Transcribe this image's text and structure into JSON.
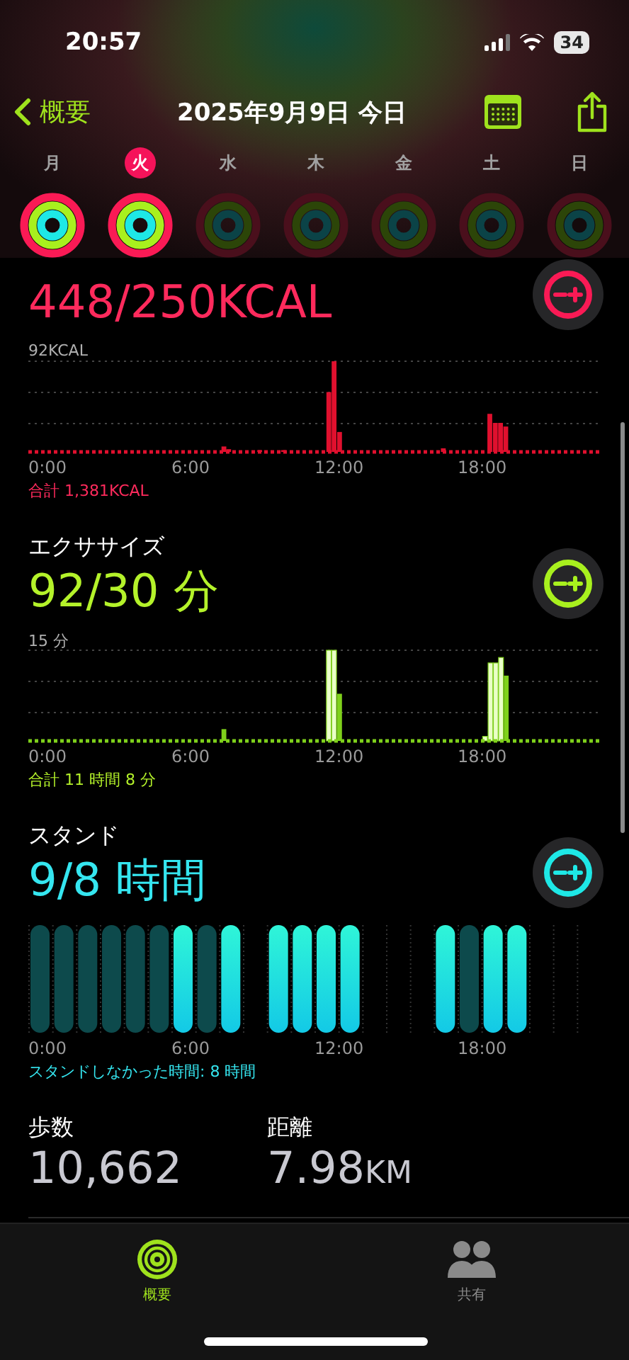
{
  "status_bar": {
    "time": "20:57",
    "battery": "34"
  },
  "nav": {
    "back": "概要",
    "title": "2025年9月9日 今日"
  },
  "week": [
    {
      "label": "月",
      "selected": false,
      "kind": "closed"
    },
    {
      "label": "火",
      "selected": true,
      "kind": "closed"
    },
    {
      "label": "水",
      "selected": false,
      "kind": "open"
    },
    {
      "label": "木",
      "selected": false,
      "kind": "open"
    },
    {
      "label": "金",
      "selected": false,
      "kind": "open"
    },
    {
      "label": "土",
      "selected": false,
      "kind": "open"
    },
    {
      "label": "日",
      "selected": false,
      "kind": "open"
    }
  ],
  "sections": [
    {
      "kind": "move",
      "value": "448/250KCAL",
      "top_label": "92KCAL",
      "x_labels": [
        "0:00",
        "6:00",
        "12:00",
        "18:00"
      ],
      "total": "合計 1,381KCAL"
    },
    {
      "kind": "exercise",
      "label": "エクササイズ",
      "value": "92/30 分",
      "top_label": "15 分",
      "x_labels": [
        "0:00",
        "6:00",
        "12:00",
        "18:00"
      ],
      "total": "合計 11 時間 8 分"
    },
    {
      "kind": "stand",
      "label": "スタンド",
      "value": "9/8 時間",
      "x_labels": [
        "0:00",
        "6:00",
        "12:00",
        "18:00"
      ],
      "total": "スタンドしなかった時間: 8 時間",
      "hours": [
        {
          "kind": "not_stood"
        },
        {
          "kind": "not_stood"
        },
        {
          "kind": "not_stood"
        },
        {
          "kind": "not_stood"
        },
        {
          "kind": "not_stood"
        },
        {
          "kind": "not_stood"
        },
        {
          "kind": "stood"
        },
        {
          "kind": "not_stood"
        },
        {
          "kind": "stood"
        },
        {
          "kind": "none"
        },
        {
          "kind": "stood"
        },
        {
          "kind": "stood"
        },
        {
          "kind": "stood"
        },
        {
          "kind": "stood"
        },
        {
          "kind": "none"
        },
        {
          "kind": "none"
        },
        {
          "kind": "none"
        },
        {
          "kind": "stood"
        },
        {
          "kind": "not_stood"
        },
        {
          "kind": "stood"
        },
        {
          "kind": "stood"
        },
        {
          "kind": "none"
        },
        {
          "kind": "none"
        },
        {
          "kind": "none"
        }
      ]
    }
  ],
  "stats": [
    {
      "label": "歩数",
      "value": "10,662"
    },
    {
      "label": "距離",
      "value": "7.98",
      "unit": "KM"
    }
  ],
  "tab_bar": [
    {
      "label": "概要",
      "kind": "summary",
      "selected": true
    },
    {
      "label": "共有",
      "kind": "sharing",
      "selected": false
    }
  ]
}
